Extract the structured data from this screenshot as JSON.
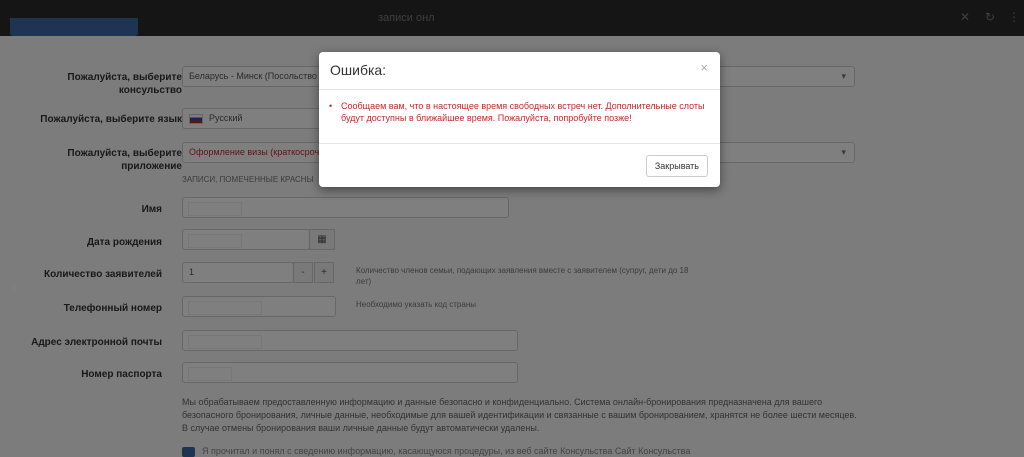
{
  "window": {
    "title": "записи онл"
  },
  "form": {
    "consulate": {
      "label": "Пожалуйста, выберите консульство",
      "value": "Беларусь - Минск (Посольство"
    },
    "language": {
      "label": "Пожалуйста, выберите язык",
      "value": "Русский"
    },
    "application": {
      "label": "Пожалуйста, выберите приложение",
      "value": "Оформление визы (краткосрочна"
    },
    "required_note": "ЗАПИСИ, ПОМЕЧЕННЫЕ КРАСНЫ",
    "name": {
      "label": "Имя"
    },
    "dob": {
      "label": "Дата рождения"
    },
    "applicants": {
      "label": "Количество заявителей",
      "value": "1",
      "minus": "-",
      "plus": "+",
      "note": "Количество членов семьи, подающих заявления вместе с заявителем (супруг, дети до 18 лет)"
    },
    "phone": {
      "label": "Телефонный номер",
      "note": "Необходимо указать код страны"
    },
    "email": {
      "label": "Адрес электронной почты"
    },
    "passport": {
      "label": "Номер паспорта"
    },
    "privacy_text": "Мы обрабатываем предоставленную информацию и данные безопасно и конфиденциально. Система онлайн-бронирования предназначена для вашего безопасного бронирования, личные данные, необходимые для вашей идентификации и связанные с вашим бронированием, хранятся не более шести месяцев. В случае отмены бронирования ваши личные данные будут автоматически удалены.",
    "consent_text": "Я прочитал и понял с сведению информацию, касающуюся процедуры, из веб сайте Консульства          Сайт Консульства"
  },
  "modal": {
    "title": "Ошибка:",
    "close_glyph": "×",
    "message": "Сообщаем вам, что в настоящее время свободных встреч нет. Дополнительные слоты будут доступны в ближайшее время. Пожалуйста, попробуйте позже!",
    "button_label": "Закрывать"
  },
  "icons": {
    "chevron": "▾",
    "calendar": "▦",
    "carousel_prev": "‹"
  },
  "colors": {
    "error_text": "#c82828",
    "accent": "#3b6aa7"
  }
}
